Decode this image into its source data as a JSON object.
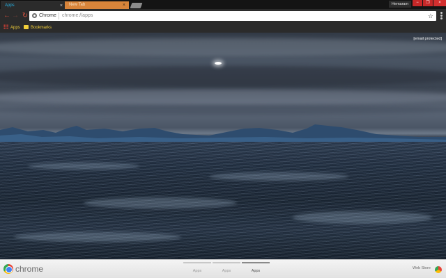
{
  "tabs": [
    {
      "label": "Apps",
      "close": "×",
      "active": true
    },
    {
      "label": "New Tab",
      "close": "×",
      "active": false
    }
  ],
  "window": {
    "profile_name": "Hemaram",
    "minimize": "−",
    "maximize": "❐",
    "close": "×"
  },
  "toolbar": {
    "back": "←",
    "forward": "→",
    "reload": "↻",
    "star": "☆"
  },
  "omnibox": {
    "site_label": "Chrome",
    "url": "chrome://apps"
  },
  "bookmarks": {
    "apps": "Apps",
    "bookmarks": "Bookmarks"
  },
  "content": {
    "user_email": "[email protected]"
  },
  "bottom": {
    "wordmark": "chrome",
    "pages": [
      {
        "label": "Apps",
        "active": false
      },
      {
        "label": "Apps",
        "active": false
      },
      {
        "label": "Apps",
        "active": true
      }
    ],
    "webstore": "Web Store"
  },
  "colors": {
    "accent_tab": "#27b3e6",
    "inactive_tab": "#d8843a",
    "bookmark_text": "#f2cf3a",
    "window_controls": "#c62828"
  }
}
